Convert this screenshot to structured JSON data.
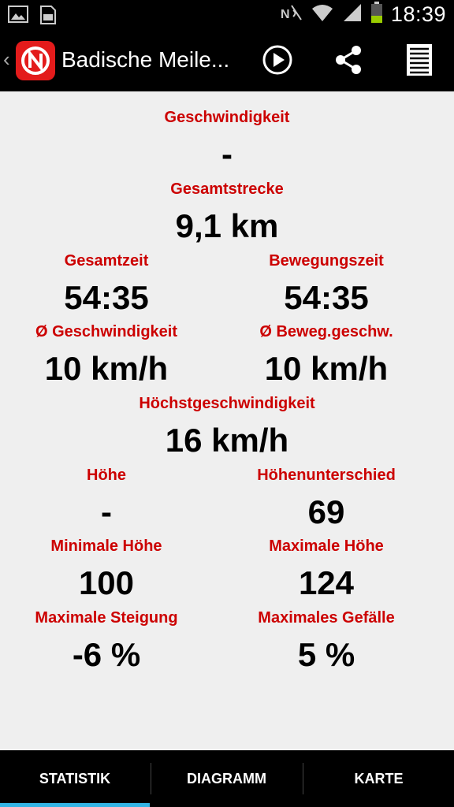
{
  "status_bar": {
    "time": "18:39",
    "icons": [
      "image-icon",
      "sd-card-icon",
      "nfc-icon",
      "wifi-icon",
      "signal-icon",
      "battery-icon"
    ]
  },
  "action_bar": {
    "title": "Badische Meile...",
    "icons": [
      "play-icon",
      "share-icon",
      "list-icon"
    ]
  },
  "stats": {
    "speed": {
      "label": "Geschwindigkeit",
      "value": "-"
    },
    "total_distance": {
      "label": "Gesamtstrecke",
      "value": "9,1 km"
    },
    "total_time": {
      "label": "Gesamtzeit",
      "value": "54:35"
    },
    "moving_time": {
      "label": "Bewegungszeit",
      "value": "54:35"
    },
    "avg_speed": {
      "label": "Ø Geschwindigkeit",
      "value": "10 km/h"
    },
    "avg_moving_speed": {
      "label": "Ø Beweg.geschw.",
      "value": "10 km/h"
    },
    "max_speed": {
      "label": "Höchstgeschwindigkeit",
      "value": "16 km/h"
    },
    "elevation": {
      "label": "Höhe",
      "value": "-"
    },
    "elevation_diff": {
      "label": "Höhenunterschied",
      "value": "69"
    },
    "min_elevation": {
      "label": "Minimale Höhe",
      "value": "100"
    },
    "max_elevation": {
      "label": "Maximale Höhe",
      "value": "124"
    },
    "max_grade": {
      "label": "Maximale Steigung",
      "value": "-6 %"
    },
    "max_descent": {
      "label": "Maximales Gefälle",
      "value": "5 %"
    }
  },
  "tabs": [
    {
      "label": "STATISTIK",
      "active": true
    },
    {
      "label": "DIAGRAMM",
      "active": false
    },
    {
      "label": "KARTE",
      "active": false
    }
  ],
  "colors": {
    "label_red": "#cc0000",
    "tab_indicator": "#33b5e5",
    "app_logo": "#e31b1b"
  }
}
